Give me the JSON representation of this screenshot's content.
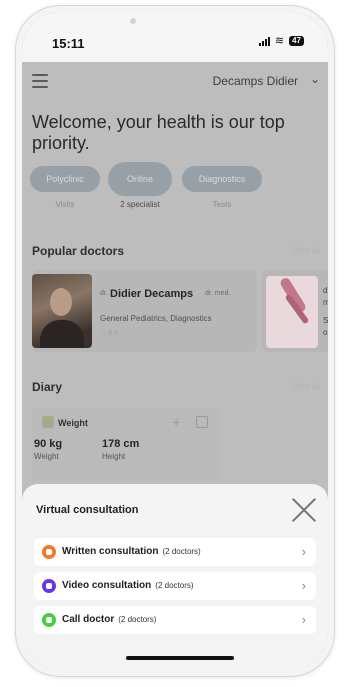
{
  "status_bar": {
    "time": "15:11",
    "battery": "47"
  },
  "header": {
    "user_name": "Decamps Didier"
  },
  "welcome_text": "Welcome, your health is our top priority.",
  "quick_actions": [
    {
      "label": "Polyclinic",
      "sub": "Visits"
    },
    {
      "label": "Online",
      "sub": "2 specialist"
    },
    {
      "label": "Diagnostics",
      "sub": "Tests"
    }
  ],
  "popular_doctors": {
    "title": "Popular doctors",
    "view_all": "View all",
    "doctors": [
      {
        "prefix": "dr.",
        "name": "Didier Decamps",
        "suffix": "dr. med.",
        "specialty": "General Pediatrics, Diagnostics",
        "rating": "☆ 5.0"
      }
    ],
    "partial_card": {
      "line1": "dr",
      "line2": "m",
      "line3": "S",
      "line4": "ol"
    }
  },
  "diary": {
    "title": "Diary",
    "view_all": "View all",
    "card": {
      "title": "Weight",
      "metrics": [
        {
          "value": "90 kg",
          "label": "Weight"
        },
        {
          "value": "178 cm",
          "label": "Height"
        }
      ]
    }
  },
  "virtual_consultation": {
    "title": "Virtual consultation",
    "options": [
      {
        "label": "Written consultation",
        "count": "(2 doctors)",
        "color": "#f07b2a"
      },
      {
        "label": "Video consultation",
        "count": "(2 doctors)",
        "color": "#6a35e6"
      },
      {
        "label": "Call doctor",
        "count": "(2 doctors)",
        "color": "#43d13a"
      }
    ]
  }
}
